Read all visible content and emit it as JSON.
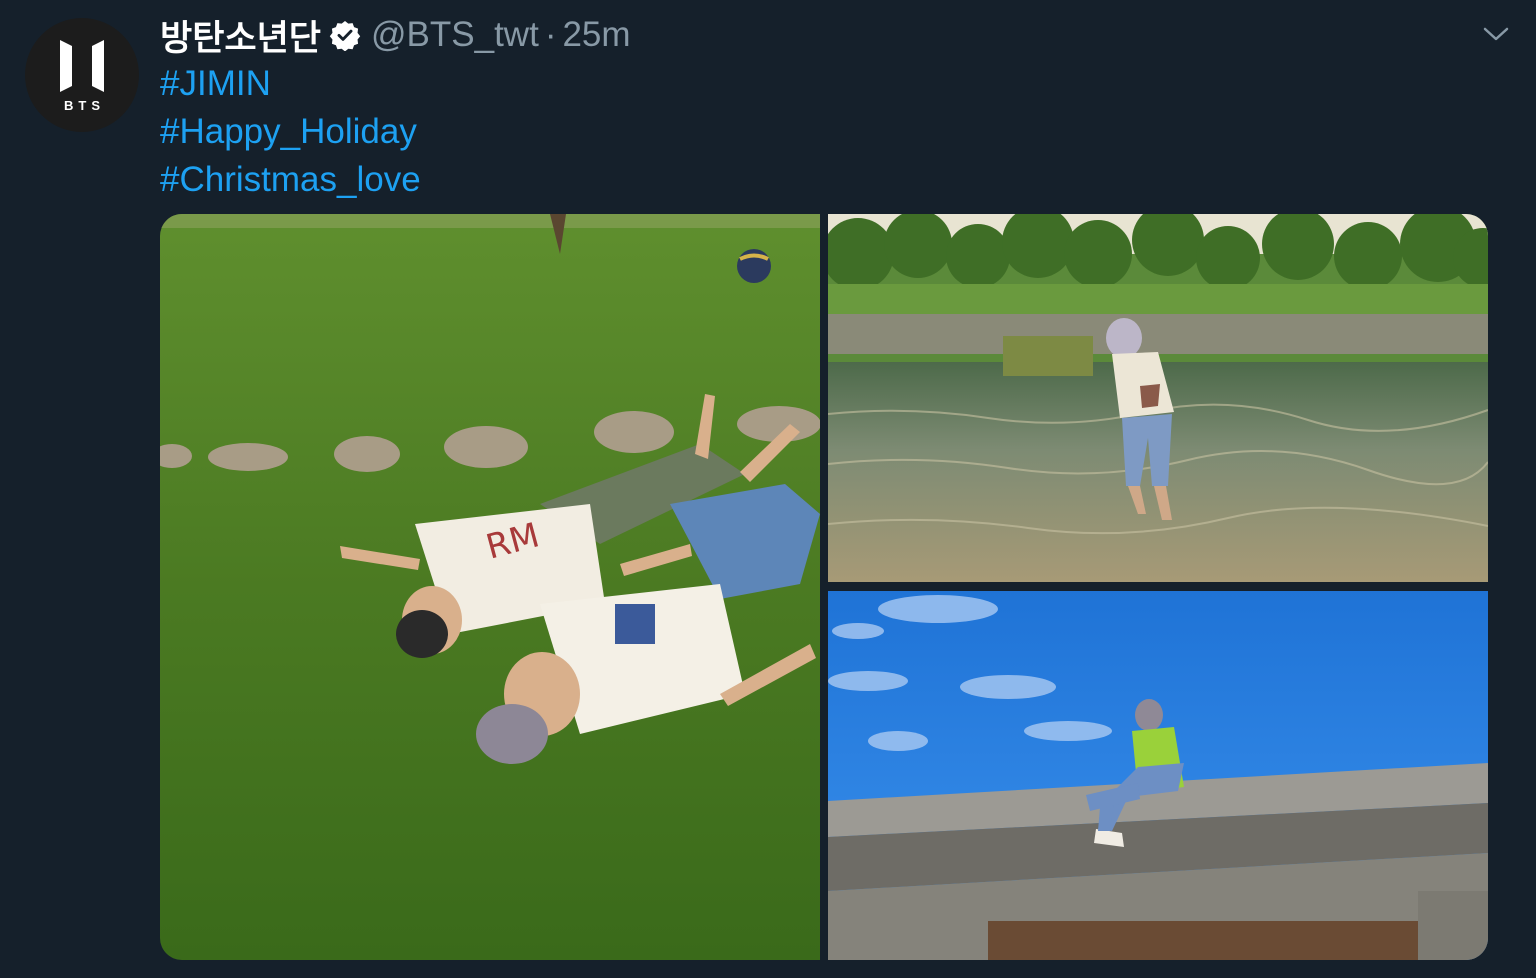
{
  "tweet": {
    "display_name": "방탄소년단",
    "handle": "@BTS_twt",
    "separator": "·",
    "time": "25m",
    "avatar_text": "BTS",
    "hashtags": [
      "#JIMIN",
      "#Happy_Holiday",
      "#Christmas_love"
    ]
  },
  "icons": {
    "verified": "verified-badge-icon",
    "more": "chevron-down-icon"
  },
  "colors": {
    "background": "#15202b",
    "link": "#1da1f2",
    "secondary_text": "#8899a6"
  }
}
